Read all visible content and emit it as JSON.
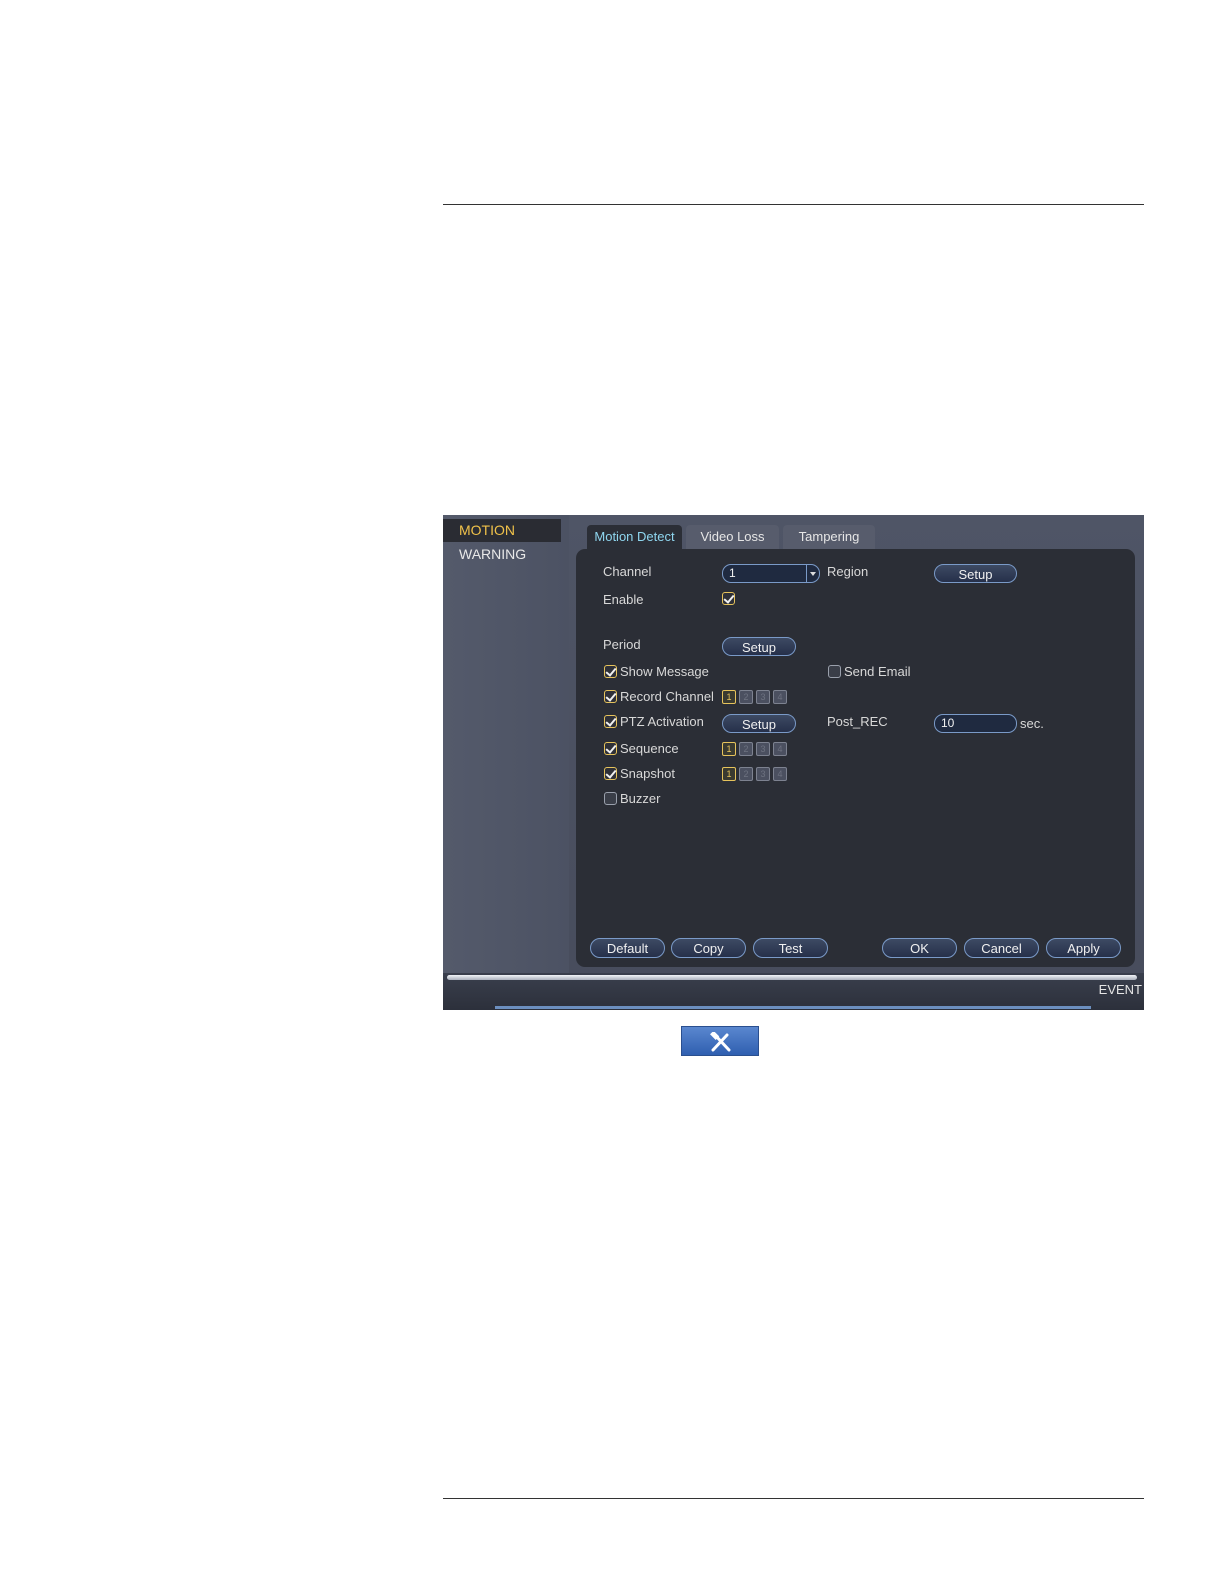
{
  "sidebar": {
    "items": [
      {
        "label": "MOTION",
        "active": true
      },
      {
        "label": "WARNING",
        "active": false
      }
    ]
  },
  "tabs": [
    {
      "label": "Motion Detect",
      "active": true
    },
    {
      "label": "Video Loss",
      "active": false
    },
    {
      "label": "Tampering",
      "active": false
    }
  ],
  "form": {
    "channel_label": "Channel",
    "channel_value": "1",
    "region_label": "Region",
    "region_button": "Setup",
    "enable_label": "Enable",
    "enable_checked": true,
    "period_label": "Period",
    "period_button": "Setup",
    "show_message_label": "Show Message",
    "send_email_label": "Send Email",
    "record_channel_label": "Record Channel",
    "ptz_label": "PTZ Activation",
    "ptz_button": "Setup",
    "post_rec_label": "Post_REC",
    "post_rec_value": "10",
    "post_rec_unit": "sec.",
    "sequence_label": "Sequence",
    "snapshot_label": "Snapshot",
    "buzzer_label": "Buzzer"
  },
  "channel_boxes": {
    "record": [
      "1",
      "2",
      "3",
      "4"
    ],
    "sequence": [
      "1",
      "2",
      "3",
      "4"
    ],
    "snapshot": [
      "1",
      "2",
      "3",
      "4"
    ]
  },
  "buttons": {
    "default": "Default",
    "copy": "Copy",
    "test": "Test",
    "ok": "OK",
    "cancel": "Cancel",
    "apply": "Apply"
  },
  "bottom_bar": {
    "label": "EVENT"
  },
  "icons": {
    "tools": "tools-icon"
  },
  "colors": {
    "active_sidebar_text": "#f0c24a",
    "active_tab_text": "#8fd6ef",
    "panel_bg": "#2b2e36",
    "button_border": "#7a9ac8",
    "checkbox_checked": "#e6c35c",
    "tools_button": "#3f6cbd"
  }
}
